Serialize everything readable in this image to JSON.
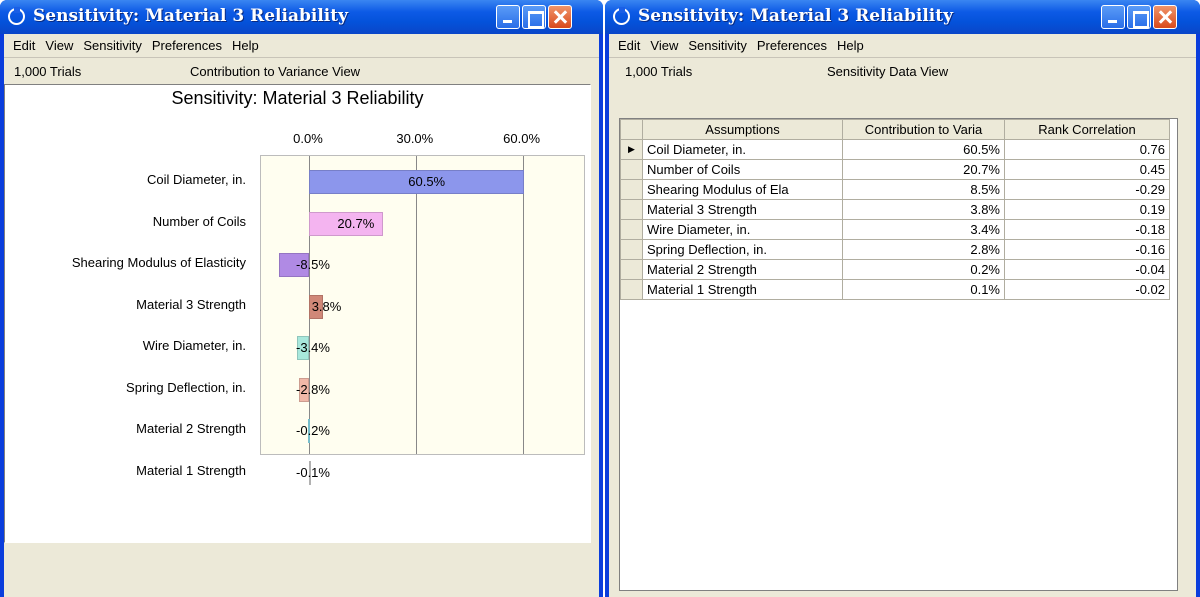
{
  "left_window": {
    "title": "Sensitivity: Material 3 Reliability",
    "menu": [
      "Edit",
      "View",
      "Sensitivity",
      "Preferences",
      "Help"
    ],
    "trials": "1,000 Trials",
    "view_name": "Contribution to Variance View",
    "chart_title": "Sensitivity: Material 3 Reliability"
  },
  "right_window": {
    "title": "Sensitivity: Material 3 Reliability",
    "menu": [
      "Edit",
      "View",
      "Sensitivity",
      "Preferences",
      "Help"
    ],
    "trials": "1,000 Trials",
    "view_name": "Sensitivity Data View",
    "table": {
      "headers": [
        "Assumptions",
        "Contribution to Varia",
        "Rank Correlation"
      ],
      "rows": [
        [
          "Coil Diameter, in.",
          "60.5%",
          "0.76"
        ],
        [
          "Number of Coils",
          "20.7%",
          "0.45"
        ],
        [
          "Shearing Modulus of Ela",
          "8.5%",
          "-0.29"
        ],
        [
          "Material 3 Strength",
          "3.8%",
          "0.19"
        ],
        [
          "Wire Diameter, in.",
          "3.4%",
          "-0.18"
        ],
        [
          "Spring Deflection, in.",
          "2.8%",
          "-0.16"
        ],
        [
          "Material 2 Strength",
          "0.2%",
          "-0.04"
        ],
        [
          "Material 1 Strength",
          "0.1%",
          "-0.02"
        ]
      ],
      "selected_row_index": 0
    }
  },
  "chart_data": {
    "type": "bar",
    "title": "Sensitivity: Material 3 Reliability",
    "orientation": "horizontal",
    "xlim": [
      -15,
      60
    ],
    "tick_labels": [
      "0.0%",
      "30.0%",
      "60.0%"
    ],
    "tick_values": [
      0,
      30,
      60
    ],
    "grid": true,
    "categories": [
      "Coil Diameter, in.",
      "Number of Coils",
      "Shearing Modulus of Elasticity",
      "Material 3 Strength",
      "Wire Diameter, in.",
      "Spring Deflection, in.",
      "Material 2 Strength",
      "Material 1 Strength"
    ],
    "values": [
      60.5,
      20.7,
      -8.5,
      3.8,
      -3.4,
      -2.8,
      -0.2,
      -0.1
    ],
    "value_labels": [
      "60.5%",
      "20.7%",
      "-8.5%",
      "3.8%",
      "-3.4%",
      "-2.8%",
      "-0.2%",
      "-0.1%"
    ],
    "colors": [
      "#8c96ec",
      "#f4b4f0",
      "#b08ae4",
      "#d08878",
      "#a8e8dc",
      "#f0b8a8",
      "#8ce0f0",
      "#d0d0d0"
    ]
  }
}
